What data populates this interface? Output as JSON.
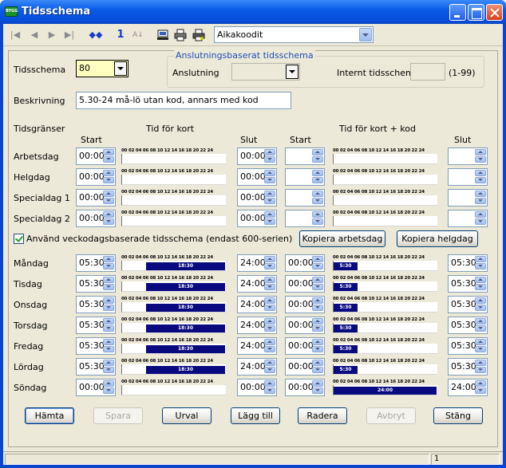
{
  "window": {
    "title": "Tidsschema",
    "app_icon_text": "BYGG"
  },
  "toolbar": {
    "record_number": "1",
    "combo_value": "Aikakoodit",
    "icons": [
      "first-record-icon",
      "prev-record-icon",
      "next-record-icon",
      "last-record-icon",
      "find-icon",
      "sort-icon",
      "computer-icon",
      "printer-icon",
      "printer-icon"
    ]
  },
  "header": {
    "tidsschema_label": "Tidsschema",
    "tidsschema_value": "80",
    "group_title": "Anslutningsbaserat tidsschema",
    "anslutning_label": "Anslutning",
    "anslutning_value": "",
    "internt_label": "Internt tidsschema",
    "internt_value": "",
    "internt_range": "(1-99)",
    "beskrivning_label": "Beskrivning",
    "beskrivning_value": "5.30-24 må-lö utan kod, annars med kod"
  },
  "scale_text": "00 02 04 06 08 10 12 14 16 18 20 22 24",
  "columns": {
    "tidsgranser": "Tidsgränser",
    "start": "Start",
    "tid_for_kort": "Tid för kort",
    "slut": "Slut",
    "start2": "Start",
    "tid_for_kort_kod": "Tid för kort + kod",
    "slut2": "Slut"
  },
  "limit_rows": [
    {
      "label": "Arbetsdag",
      "start": "00:00",
      "slut": "00:00",
      "start2": "",
      "slut2": ""
    },
    {
      "label": "Helgdag",
      "start": "00:00",
      "slut": "00:00",
      "start2": "",
      "slut2": ""
    },
    {
      "label": "Specialdag 1",
      "start": "00:00",
      "slut": "00:00",
      "start2": "",
      "slut2": ""
    },
    {
      "label": "Specialdag 2",
      "start": "00:00",
      "slut": "00:00",
      "start2": "",
      "slut2": ""
    }
  ],
  "weekday": {
    "checkbox_label": "Använd veckodagsbaserade tidsschema (endast 600-serien)",
    "checked": true,
    "copy_workday": "Kopiera arbetsdag",
    "copy_holiday": "Kopiera helgdag"
  },
  "day_rows": [
    {
      "label": "Måndag",
      "start": "05:30",
      "slut": "24:00",
      "bar1": {
        "from": 5.5,
        "to": 24,
        "text": "18:30"
      },
      "start2": "00:00",
      "slut2": "05:30",
      "bar2": {
        "from": 0,
        "to": 5.5,
        "text": "5:30"
      }
    },
    {
      "label": "Tisdag",
      "start": "05:30",
      "slut": "24:00",
      "bar1": {
        "from": 5.5,
        "to": 24,
        "text": "18:30"
      },
      "start2": "00:00",
      "slut2": "05:30",
      "bar2": {
        "from": 0,
        "to": 5.5,
        "text": "5:30"
      }
    },
    {
      "label": "Onsdag",
      "start": "05:30",
      "slut": "24:00",
      "bar1": {
        "from": 5.5,
        "to": 24,
        "text": "18:30"
      },
      "start2": "00:00",
      "slut2": "05:30",
      "bar2": {
        "from": 0,
        "to": 5.5,
        "text": "5:30"
      }
    },
    {
      "label": "Torsdag",
      "start": "05:30",
      "slut": "24:00",
      "bar1": {
        "from": 5.5,
        "to": 24,
        "text": "18:30"
      },
      "start2": "00:00",
      "slut2": "05:30",
      "bar2": {
        "from": 0,
        "to": 5.5,
        "text": "5:30"
      }
    },
    {
      "label": "Fredag",
      "start": "05:30",
      "slut": "24:00",
      "bar1": {
        "from": 5.5,
        "to": 24,
        "text": "18:30"
      },
      "start2": "00:00",
      "slut2": "05:30",
      "bar2": {
        "from": 0,
        "to": 5.5,
        "text": "5:30"
      }
    },
    {
      "label": "Lördag",
      "start": "05:30",
      "slut": "24:00",
      "bar1": {
        "from": 5.5,
        "to": 24,
        "text": "18:30"
      },
      "start2": "00:00",
      "slut2": "05:30",
      "bar2": {
        "from": 0,
        "to": 5.5,
        "text": "5:30"
      }
    },
    {
      "label": "Söndag",
      "start": "00:00",
      "slut": "00:00",
      "bar1": null,
      "start2": "00:00",
      "slut2": "24:00",
      "bar2": {
        "from": 0,
        "to": 24,
        "text": "24:00"
      }
    }
  ],
  "buttons": [
    {
      "label": "Hämta",
      "enabled": true,
      "default": true
    },
    {
      "label": "Spara",
      "enabled": false
    },
    {
      "label": "Urval",
      "enabled": true
    },
    {
      "label": "Lägg till",
      "enabled": true
    },
    {
      "label": "Radera",
      "enabled": true
    },
    {
      "label": "Avbryt",
      "enabled": false
    },
    {
      "label": "Stäng",
      "enabled": true
    }
  ],
  "status": {
    "pane2": "1"
  },
  "colors": {
    "bar": "#0a0a80",
    "titlebar": "#0a5ce8",
    "dialog": "#ece9d8",
    "highlight_field": "#ffffc0"
  }
}
